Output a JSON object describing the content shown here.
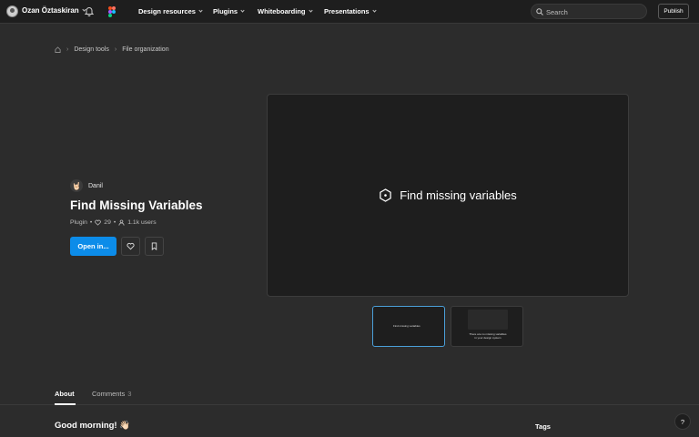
{
  "topbar": {
    "user_name": "Ozan Öztaskiran",
    "nav": [
      {
        "label": "Design resources"
      },
      {
        "label": "Plugins"
      },
      {
        "label": "Whiteboarding"
      },
      {
        "label": "Presentations"
      }
    ],
    "search": {
      "placeholder": "Search",
      "value": ""
    },
    "publish_label": "Publish",
    "icons": [
      "user-avatar",
      "chevron-down-icon",
      "bell-icon",
      "figma-logo",
      "search-icon"
    ]
  },
  "breadcrumb": {
    "items": [
      "Design tools",
      "File organization"
    ],
    "home_icon": "home-icon"
  },
  "plugin": {
    "author": "Danil",
    "author_avatar": "🤘🏻",
    "title": "Find Missing Variables",
    "type": "Plugin",
    "separator": "•",
    "likes": "29",
    "users": "1.1k users",
    "open_label": "Open in...",
    "like_icon": "heart-icon",
    "save_icon": "bookmark-icon"
  },
  "preview": {
    "text": "Find missing variables",
    "icon": "hexagon-icon",
    "thumbnails": [
      {
        "text": "Find missing variables",
        "active": true
      },
      {
        "text": "There are no missing variables in your design system",
        "active": false
      }
    ]
  },
  "tabs": {
    "about": "About",
    "comments": "Comments",
    "comments_count": "3"
  },
  "content": {
    "greeting": "Good morning! 👋🏻",
    "tags_heading": "Tags"
  },
  "help_label": "?",
  "colors": {
    "background": "#2c2c2c",
    "topbar": "#1e1e1e",
    "accent": "#0c8ce9",
    "thumb_active_border": "#4a9fd8"
  }
}
